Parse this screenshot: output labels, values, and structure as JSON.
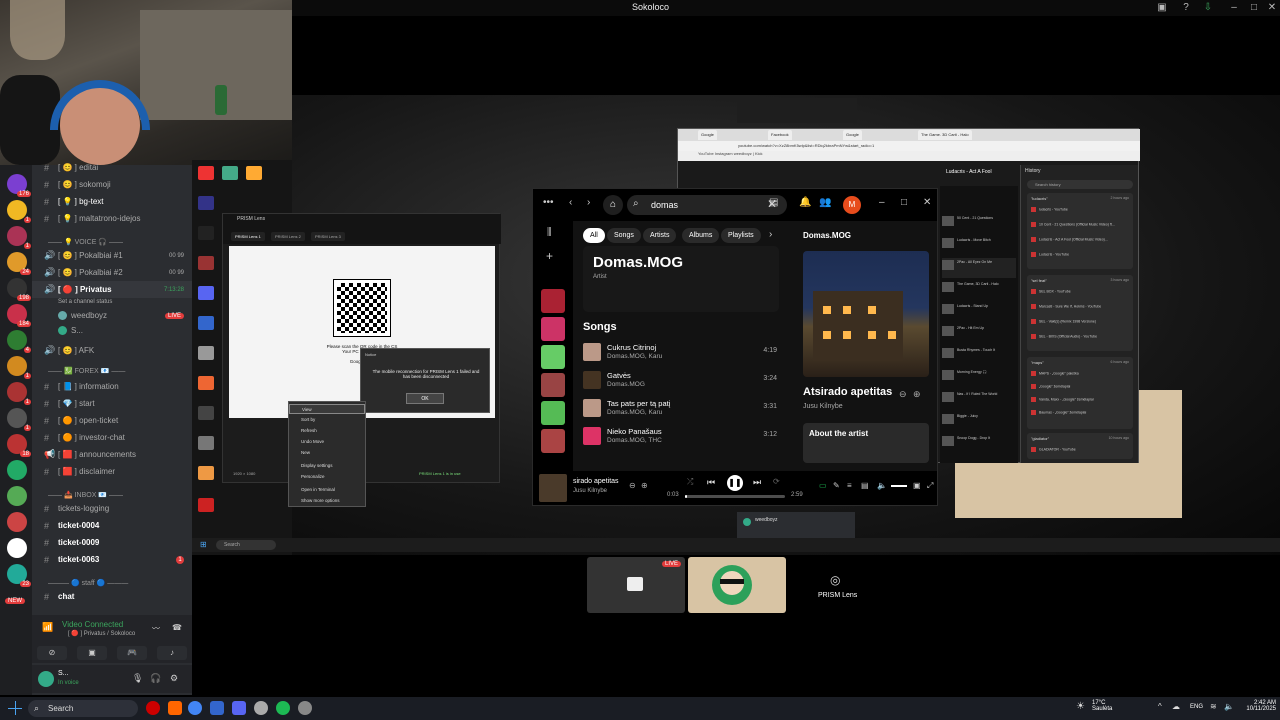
{
  "window": {
    "title": "Sokoloco"
  },
  "discord": {
    "channels": [
      {
        "icon": "#",
        "label": "[ 😊 ] editai"
      },
      {
        "icon": "#",
        "label": "[ 😊 ] sokomoji"
      },
      {
        "icon": "#",
        "label": "[ 💡 ] bg-text"
      },
      {
        "icon": "#",
        "label": "[ 💡 ] maltatrono-idejos"
      }
    ],
    "voice_category": "—— 💡 VOICE 🎧 ——",
    "voice_channels": [
      {
        "label": "[ 😊 ] Pokalbiai #1",
        "count": "00 99"
      },
      {
        "label": "[ 😊 ] Pokalbiai #2",
        "count": "00 99"
      }
    ],
    "active_voice": {
      "label": "[ 🔴 ] Privatus",
      "time": "7:13:28",
      "status": "Set a channel status"
    },
    "voice_users": [
      {
        "name": "weedboyz",
        "badge": "LIVE"
      },
      {
        "name": "S..."
      }
    ],
    "afk": "[ 😊 ] AFK",
    "forex_category": "—— 💹 FOREX 📧 ——",
    "forex_channels": [
      "[ 📘 ] information",
      "[ 💎 ] start",
      "[ 🟠 ] open-ticket",
      "[ 🟠 ] investor-chat",
      "[ 🟥 ] announcements",
      "[ 🟥 ] disclaimer"
    ],
    "inbox_category": "—— 📥 INBOX 📧 ——",
    "inbox_channels": [
      "tickets-logging",
      "ticket-0004",
      "ticket-0009",
      "ticket-0063"
    ],
    "ticket_badge": "1",
    "staff_category": "——— 🔵 staff 🔵 ———",
    "staff_channels": [
      "chat"
    ],
    "video": {
      "title": "Video Connected",
      "sub": "[ 🔴 ] Privatus / Sokoloco"
    },
    "user": {
      "name": "S...",
      "status": "In voice"
    },
    "server_badges": [
      "176",
      "1",
      "1",
      "24",
      "198",
      "184",
      "4",
      "1",
      "1",
      "1",
      "18",
      "23"
    ],
    "new_badge": "NEW"
  },
  "prism": {
    "title": "PRISM Lens",
    "tabs": [
      "PRISM Lens 1",
      "PRISM Lens 2",
      "PRISM Lens 3"
    ],
    "scan_text": "Please scan the QR code in the CS",
    "scan_sub": "Your PC and mobile",
    "google_play": "Google Play",
    "dialog_title": "Notice",
    "dialog_msg": "The mobile reconnection for PRISM Lens 1 failed and has been disconnected",
    "dialog_ok": "OK",
    "status": "PRISM Lens 1 is in use",
    "res": "1920 × 1080"
  },
  "context_menu": [
    "View",
    "Sort by",
    "Refresh",
    "Undo Move",
    "New",
    "Display settings",
    "Personalize",
    "Open in Terminal",
    "Show more options"
  ],
  "spotify": {
    "search": "domas",
    "avatar": "M",
    "chips": [
      "All",
      "Songs",
      "Artists",
      "Albums",
      "Playlists"
    ],
    "artist": "Domas.MOG",
    "artist_label": "Artist",
    "songs_heading": "Songs",
    "songs": [
      {
        "title": "Cukrus Citrinoj",
        "artist": "Domas.MOG, Karu",
        "dur": "4:19"
      },
      {
        "title": "Gatvės",
        "artist": "Domas.MOG",
        "dur": "3:24"
      },
      {
        "title": "Tas pats per tą patį",
        "artist": "Domas.MOG, Karu",
        "dur": "3:31"
      },
      {
        "title": "Nieko Panašaus",
        "artist": "Domas.MOG, THC",
        "dur": "3:12"
      }
    ],
    "right_title": "Domas.MOG",
    "track": "Atsirado apetitas",
    "track_artist": "Jusu Kilnybe",
    "about": "About the artist",
    "np_title": "sirado apetitas",
    "np_artist": "Jusu Kilnybe",
    "time_cur": "0:03",
    "time_total": "2:59",
    "progress": 0.02
  },
  "chrome": {
    "tabs": [
      "Google",
      "Facebook",
      "Google",
      "The Game. 3D Carti - Halo"
    ],
    "url": "youtube.com/watch?v=XzZ8bmK5wlp&list=RDiq2kbraPmNYw&start_radio=1",
    "bookmarks": "YouTube  Instagram  weedboyz | Kick",
    "history_title": "History",
    "history_search": "Search history",
    "groups": [
      {
        "q": "\"ludacris\"",
        "t": "2 hours ago",
        "rows": [
          "ludacris - YouTube",
          "10 Cent - 21 Questions (Official Music Video) ft...",
          "Ludacris - Act A Fool (Official Music Video)...",
          "Ludacris - YouTube"
        ]
      },
      {
        "q": "\"sel feat\"",
        "t": "3 hours ago",
        "rows": [
          "SEL BOX - YouTube",
          "Marcasti - Sure We If, Hokins - YouTube",
          "SEL - Vakt(s) (Remix 1998 Versione)",
          "SEL - BIXS (Official Audio) - YouTube"
        ]
      },
      {
        "q": "\"maps\"",
        "t": "6 hours ago",
        "rows": [
          "MAPS - „Google“ paieška",
          "„Google“ žemėlapiai",
          "Vanda, Maxx - „Google“ žemėlapiai",
          "Baumas - „Google“ žemėlapiai"
        ]
      },
      {
        "q": "\"gladiator\"",
        "t": "10 hours ago",
        "rows": [
          "GLADIATOR - YouTube"
        ]
      }
    ],
    "yt_title": "Ludacris - Act A Fool",
    "yt_list": [
      "50 Cent - 21 Questions",
      "Ludacris - Move Bitch",
      "2Pac - All Eyez On Me",
      "The Game, 3D Carti - Halo",
      "Ludacris - Stand Up",
      "2Pac - Hit Em Up",
      "Busta Rhymes - Touch It",
      "Morning Energy 🎧",
      "Nas - If I Ruled The World",
      "Biggie - Juicy",
      "Snoop Dogg - Drop It"
    ]
  },
  "tiles": {
    "live": "LIVE",
    "prism_label": "PRISM Lens"
  },
  "taskbar": {
    "search": "Search",
    "weather_temp": "17°C",
    "weather_desc": "Saulėta",
    "lang": "ENG",
    "time": "2:42 AM",
    "date": "10/11/2025"
  },
  "inner_taskbar": {
    "search": "Search"
  }
}
